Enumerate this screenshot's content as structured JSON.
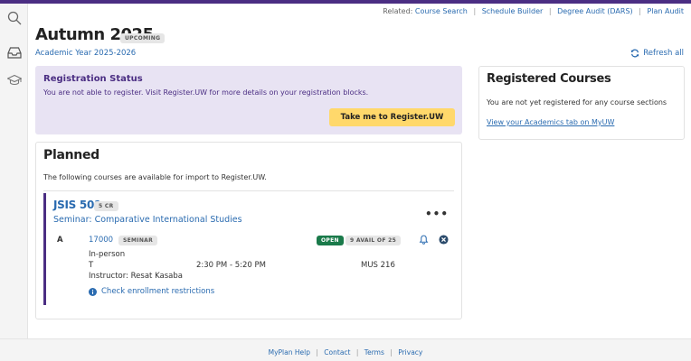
{
  "rail": {
    "icons": [
      "search-icon",
      "inbox-icon",
      "graduation-cap-icon"
    ]
  },
  "related": {
    "label": "Related:",
    "links": [
      "Course Search",
      "Schedule Builder",
      "Degree Audit (DARS)",
      "Plan Audit"
    ],
    "separator": "|"
  },
  "header": {
    "title": "Autumn 2025",
    "badge": "UPCOMING",
    "academic_year": "Academic Year 2025-2026",
    "refresh_label": "Refresh all"
  },
  "registration_status": {
    "title": "Registration Status",
    "message": "You are not able to register. Visit Register.UW for more details on your registration blocks.",
    "button_label": "Take me to Register.UW"
  },
  "registered": {
    "title": "Registered Courses",
    "message": "You are not yet registered for any course sections",
    "link": "View your Academics tab on MyUW"
  },
  "planned": {
    "title": "Planned",
    "intro": "The following courses are available for import to Register.UW.",
    "course": {
      "code": "JSIS 501",
      "credits": "5 CR",
      "name": "Seminar: Comparative International Studies",
      "more": "•••",
      "section": {
        "letter": "A",
        "number": "17000",
        "type": "SEMINAR",
        "status": "OPEN",
        "availability": "9 AVAIL OF 25",
        "mode": "In-person",
        "day": "T",
        "time": "2:30 PM - 5:20 PM",
        "room": "MUS 216",
        "instructor": "Instructor: Resat Kasaba",
        "restrictions_link": "Check enrollment restrictions"
      }
    }
  },
  "footer": {
    "links": [
      "MyPlan Help",
      "Contact",
      "Terms",
      "Privacy"
    ],
    "separator": "|"
  },
  "colors": {
    "brand_purple": "#4b2e83",
    "link_blue": "#2a6bb0",
    "status_bg": "#e8e3f3",
    "button_gold": "#ffd86b",
    "open_green": "#1a7a4a"
  }
}
